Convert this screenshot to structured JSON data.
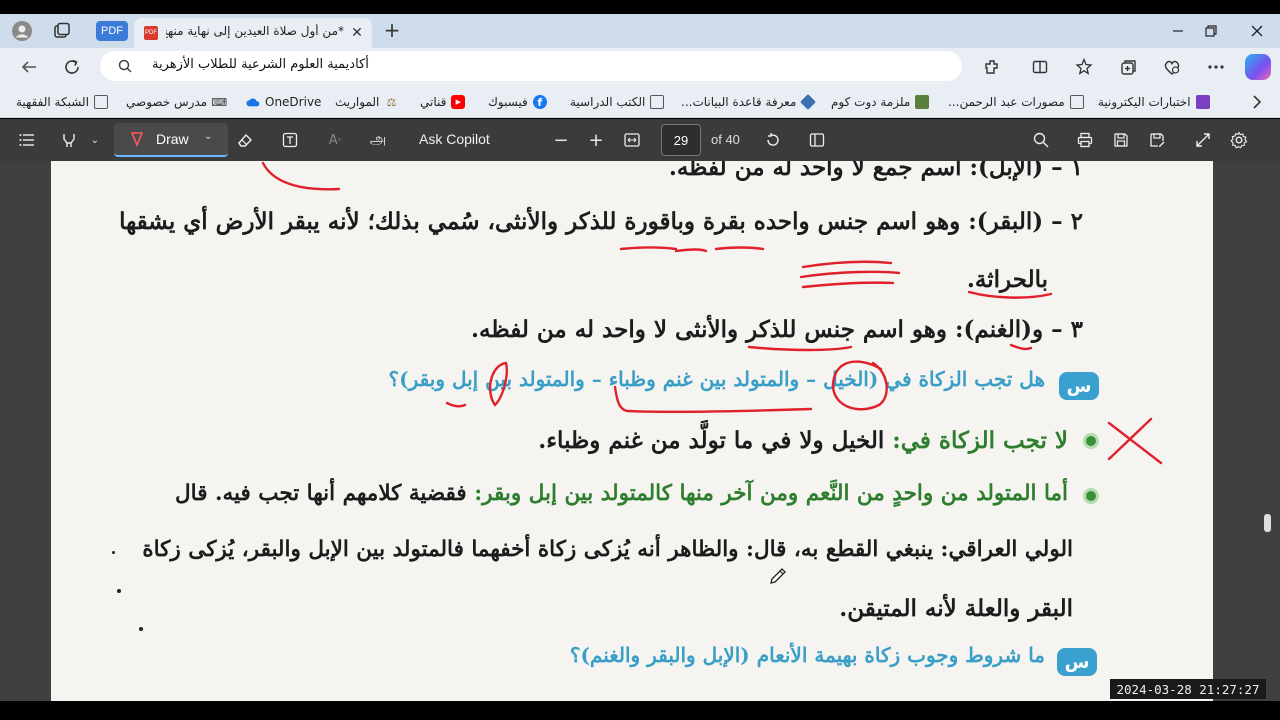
{
  "browser": {
    "pdf_pill": "PDF",
    "tab_title": "*من أول صلاة العيدين إلى نهاية منهج",
    "new_tab": "+",
    "address": "أكاديمية العلوم الشرعية للطلاب الأزهرية"
  },
  "bookmarks": [
    {
      "label": "اختبارات اليكترونية",
      "icon": "form-icon"
    },
    {
      "label": "مصورات عبد الرحمن...",
      "icon": "page-icon"
    },
    {
      "label": "ملزمة دوت كوم",
      "icon": "image-icon"
    },
    {
      "label": "معرفة قاعدة البيانات...",
      "icon": "diamond-icon"
    },
    {
      "label": "الكتب الدراسية",
      "icon": "page-icon"
    },
    {
      "label": "فيسبوك",
      "icon": "facebook-icon"
    },
    {
      "label": "قناتي",
      "icon": "youtube-icon"
    },
    {
      "label": "المواريث",
      "icon": "scale-icon"
    },
    {
      "label": "OneDrive",
      "icon": "onedrive-icon"
    },
    {
      "label": "مدرس خصوصي",
      "icon": "teacher-icon"
    },
    {
      "label": "الشبكة الفقهية",
      "icon": "page-icon"
    }
  ],
  "pdf_toolbar": {
    "draw_label": "Draw",
    "ask_copilot": "Ask Copilot",
    "page_number": "29",
    "page_total": "of 40"
  },
  "document": {
    "line1": "١ – (الإبل): اسم جمع لا واحد له من لفظه.",
    "line2": "٢ – (البقر): وهو اسم جنس واحده بقرة وباقورة للذكر والأنثى، سُمي بذلك؛ لأنه يبقر الأرض أي يشقها",
    "line3": "بالحراثة.",
    "line4": "٣ – و(الغنم): وهو اسم جنس للذكر والأنثى لا واحد له من لفظه.",
    "q1_badge": "س",
    "q1": "هل تجب الزكاة في (الخيل – والمتولد بين غنم وظباء – والمتولد بين إبل وبقر)؟",
    "a1_lead": "لا تجب الزكاة في:",
    "a1_rest": " الخيل ولا في ما تولَّد من غنم وظباء.",
    "a2_lead": "أما المتولد من واحدٍ من النَّعم ومن آخر منها كالمتولد بين إبل وبقر:",
    "a2_rest": " فقضية كلامهم أنها تجب فيه. قال",
    "a2_line2": "الولي العراقي: ينبغي القطع به، قال: والظاهر أنه يُزكى زكاة أخفهما فالمتولد بين الإبل والبقر، يُزكى زكاة",
    "a2_line3": "البقر والعلة  لأنه المتيقن.",
    "q2_badge": "س",
    "q2": "ما شروط وجوب زكاة بهيمة الأنعام (الإبل والبقر والغنم)؟"
  },
  "timestamp": "2024-03-28  21:27:27",
  "colors": {
    "ink_red": "#e0202a",
    "accent_blue": "#3a9fc7",
    "toolbar_dark": "#3b3b3b"
  }
}
